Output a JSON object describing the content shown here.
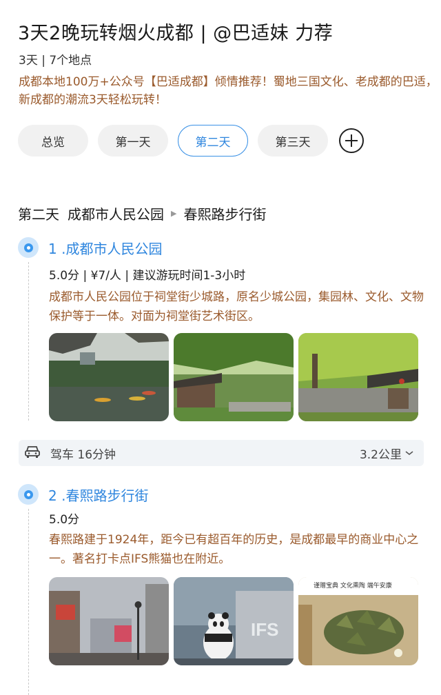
{
  "guide": {
    "title": "3天2晚玩转烟火成都 | @巴适妹 力荐",
    "meta": "3天 | 7个地点",
    "intro": "成都本地100万+公众号【巴适成都】倾情推荐！蜀地三国文化、老成都的巴适，新成都的潮流3天轻松玩转！"
  },
  "tabs": [
    {
      "label": "总览"
    },
    {
      "label": "第一天"
    },
    {
      "label": "第二天",
      "active": true
    },
    {
      "label": "第三天"
    }
  ],
  "route": {
    "day": "第二天",
    "from": "成都市人民公园",
    "to": "春熙路步行街"
  },
  "stops": [
    {
      "title": "1 .成都市人民公园",
      "meta": "5.0分 | ¥7/人 | 建议游玩时间1-3小时",
      "desc": "成都市人民公园位于祠堂街少城路，原名少城公园，集园林、文化、文物保护等于一体。对面为祠堂街艺术街区。"
    },
    {
      "title": "2 .春熙路步行街",
      "meta": "5.0分",
      "desc": "春熙路建于1924年，距今已有超百年的历史，是成都最早的商业中心之一。著名打卡点IFS熊猫也在附近。",
      "photo3_caption": "谨赠宝典  文化熏陶  端午安康"
    }
  ],
  "travel": {
    "mode": "驾车 16分钟",
    "distance": "3.2公里"
  },
  "colors": {
    "accent": "#2f86de",
    "desc_text": "#9a5a2c",
    "tab_bg": "#f1f1f1"
  }
}
